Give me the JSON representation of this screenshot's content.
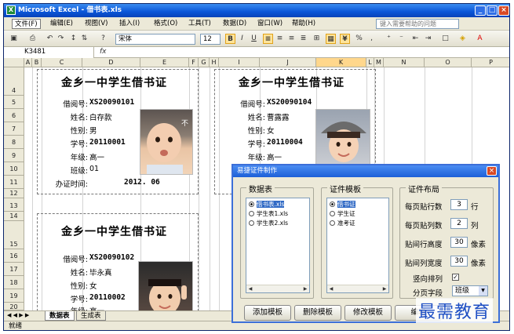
{
  "window": {
    "title": "Microsoft Excel - 借书表.xls",
    "logo": "X"
  },
  "menu": [
    "文件(F)",
    "编辑(E)",
    "视图(V)",
    "插入(I)",
    "格式(O)",
    "工具(T)",
    "数据(D)",
    "窗口(W)",
    "帮助(H)"
  ],
  "help_placeholder": "键入需要帮助的问题",
  "toolbar": {
    "font": "宋体",
    "size": "12",
    "bold": "B",
    "italic": "I",
    "underline": "U",
    "percent": "%"
  },
  "formula": {
    "namebox": "K3481",
    "fx": "fx"
  },
  "columns": [
    "A",
    "B",
    "C",
    "D",
    "E",
    "F",
    "G",
    "H",
    "I",
    "J",
    "K",
    "L",
    "M",
    "N",
    "O",
    "P"
  ],
  "rows": [
    "4",
    "5",
    "6",
    "7",
    "8",
    "9",
    "10",
    "11",
    "12",
    "13",
    "14",
    "15",
    "16",
    "17",
    "18",
    "19",
    "20"
  ],
  "card_labels": {
    "title": "金乡一中学生借书证",
    "no": "借阅号:",
    "name": "姓名:",
    "gender": "性别:",
    "id": "学号:",
    "grade": "年级:",
    "class": "班级:",
    "time": "办证时间:"
  },
  "cards": [
    {
      "no": "XS20090101",
      "name": "白存款",
      "gender": "男",
      "id": "20110001",
      "grade": "高一",
      "class": "01",
      "time": "2012. 06"
    },
    {
      "no": "XS20090104",
      "name": "曹露露",
      "gender": "女",
      "id": "20110004",
      "grade": "高一"
    },
    {
      "no": "XS20090102",
      "name": "毕永真",
      "gender": "女",
      "id": "20110002",
      "grade": "高一"
    }
  ],
  "sheet_tabs": [
    "数据表",
    "生成表"
  ],
  "status": "就绪",
  "dialog": {
    "title": "易捷证件制作",
    "data_group": "数据表",
    "data_items": [
      "借书表.xls",
      "学生表1.xls",
      "学生表2.xls"
    ],
    "template_group": "证件模板",
    "template_items": [
      "借书证",
      "学生证",
      "准考证"
    ],
    "layout_group": "证件布局",
    "rows_per_page_label": "每页贴行数",
    "rows_per_page": "3",
    "rows_unit": "行",
    "cols_per_page_label": "每页贴列数",
    "cols_per_page": "2",
    "cols_unit": "列",
    "row_height_label": "贴间行高度",
    "row_height": "30",
    "row_height_unit": "像素",
    "col_width_label": "贴间列宽度",
    "col_width": "30",
    "col_width_unit": "像素",
    "vertical_label": "竖向排列",
    "vertical_check": "✓",
    "page_field_label": "分页字段",
    "page_field": "班级",
    "buttons": [
      "添加模板",
      "删除模板",
      "修改模板",
      "编辑"
    ]
  },
  "watermark": "最需教育"
}
